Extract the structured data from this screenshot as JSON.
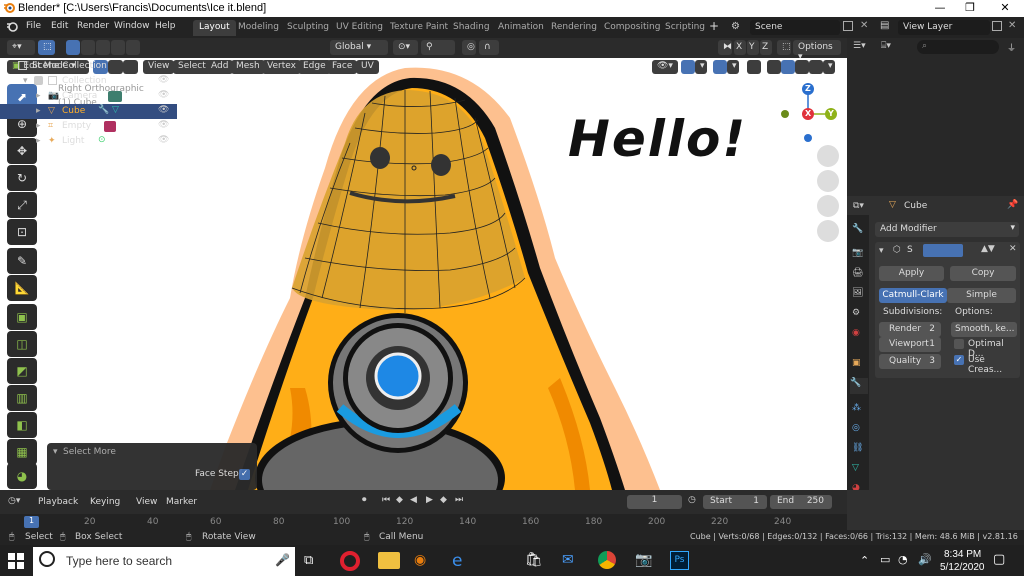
{
  "window": {
    "title": "Blender* [C:\\Users\\Francis\\Documents\\Ice it.blend]",
    "minimize": "—",
    "maximize": "❐",
    "close": "✕"
  },
  "menu": [
    "File",
    "Edit",
    "Render",
    "Window",
    "Help"
  ],
  "workspaces": [
    "Layout",
    "Modeling",
    "Sculpting",
    "UV Editing",
    "Texture Paint",
    "Shading",
    "Animation",
    "Rendering",
    "Compositing",
    "Scripting"
  ],
  "active_workspace": "Layout",
  "scene": "Scene",
  "view_layer": "View Layer",
  "tool_header": {
    "orientation": "Global",
    "axis_x": "X",
    "axis_y": "Y",
    "axis_z": "Z",
    "options": "Options"
  },
  "viewport_header": {
    "mode": "Edit Mode",
    "menus": [
      "View",
      "Select",
      "Add",
      "Mesh",
      "Vertex",
      "Edge",
      "Face",
      "UV"
    ]
  },
  "viewport": {
    "view_name": "Right Orthographic",
    "object_name": "(1) Cube",
    "hello_text": "Hello!",
    "gizmo": {
      "z": "Z",
      "y": "Y",
      "x": "X"
    }
  },
  "redo_panel": {
    "title": "Select More",
    "option_label": "Face Step",
    "option_checked": true
  },
  "outliner": {
    "root": "Scene Collection",
    "items": [
      {
        "name": "Collection",
        "depth": 1
      },
      {
        "name": "Camera",
        "depth": 2
      },
      {
        "name": "Cube",
        "depth": 2,
        "selected": true
      },
      {
        "name": "Empty",
        "depth": 2
      },
      {
        "name": "Light",
        "depth": 2
      }
    ]
  },
  "properties": {
    "object_name": "Cube",
    "add_modifier": "Add Modifier",
    "modifier_short": "S",
    "apply": "Apply",
    "copy": "Copy",
    "catmull": "Catmull-Clark",
    "simple": "Simple",
    "subdivisions_label": "Subdivisions:",
    "options_label": "Options:",
    "render_label": "Render",
    "render_value": "2",
    "viewport_label": "Viewport",
    "viewport_value": "1",
    "quality_label": "Quality",
    "quality_value": "3",
    "uv_smooth": "Smooth, ke...",
    "optimal_display": "Optimal D...",
    "optimal_checked": false,
    "use_creases": "Use Creas...",
    "use_creases_checked": true
  },
  "timeline": {
    "menus": [
      "Playback",
      "Keying",
      "View",
      "Marker"
    ],
    "current_frame": "1",
    "start_label": "Start",
    "start": "1",
    "end_label": "End",
    "end": "250",
    "ruler": [
      "1",
      "20",
      "40",
      "60",
      "80",
      "100",
      "120",
      "140",
      "160",
      "180",
      "200",
      "220",
      "240"
    ]
  },
  "statusbar": {
    "select": "Select",
    "box_select": "Box Select",
    "rotate_view": "Rotate View",
    "call_menu": "Call Menu",
    "stats": "Cube | Verts:0/68 | Edges:0/132 | Faces:0/66 | Tris:132 | Mem: 48.6 MiB | v2.81.16"
  },
  "taskbar": {
    "search_placeholder": "Type here to search",
    "time": "8:34 PM",
    "date": "5/12/2020"
  },
  "colors": {
    "accent": "#4772b3",
    "orange": "#ffae17",
    "selected_row": "#334d80",
    "bg": "#303030"
  }
}
